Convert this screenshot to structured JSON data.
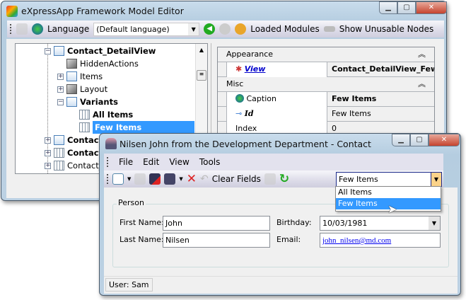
{
  "model_editor": {
    "title": "eXpressApp Framework Model Editor",
    "toolbar": {
      "language_label": "Language",
      "language_value": "(Default language)",
      "loaded_modules": "Loaded Modules",
      "show_unusable": "Show Unusable Nodes"
    },
    "tree": [
      {
        "label": "Contact_DetailView",
        "bold": true
      },
      {
        "label": "HiddenActions"
      },
      {
        "label": "Items"
      },
      {
        "label": "Layout"
      },
      {
        "label": "Variants",
        "bold": true
      },
      {
        "label": "All Items",
        "bold": true
      },
      {
        "label": "Few Items",
        "bold": true,
        "selected": true
      },
      {
        "label": "Contact_",
        "bold": true
      },
      {
        "label": "Contact_",
        "bold": true
      },
      {
        "label": "Contact_"
      }
    ],
    "properties": {
      "cat_appearance": "Appearance",
      "view_name": "View",
      "view_value": "Contact_DetailView_Few...",
      "cat_misc": "Misc",
      "caption_name": "Caption",
      "caption_value": "Few Items",
      "id_name": "Id",
      "id_value": "Few Items",
      "index_name": "Index",
      "index_value": "0"
    }
  },
  "contact_window": {
    "title": "Nilsen John from the Development Department - Contact",
    "menu": [
      "File",
      "Edit",
      "View",
      "Tools"
    ],
    "toolbar": {
      "clear_fields": "Clear Fields",
      "variant_value": "Few Items"
    },
    "variant_options": [
      "All Items",
      "Few Items"
    ],
    "group_title": "Person",
    "fields": {
      "first_name_label": "First Name:",
      "first_name": "John",
      "last_name_label": "Last Name:",
      "last_name": "Nilsen",
      "birthday_label": "Birthday:",
      "birthday": "10/03/1981",
      "email_label": "Email:",
      "email": "john_nilsen@md.com"
    },
    "status": "User: Sam"
  }
}
